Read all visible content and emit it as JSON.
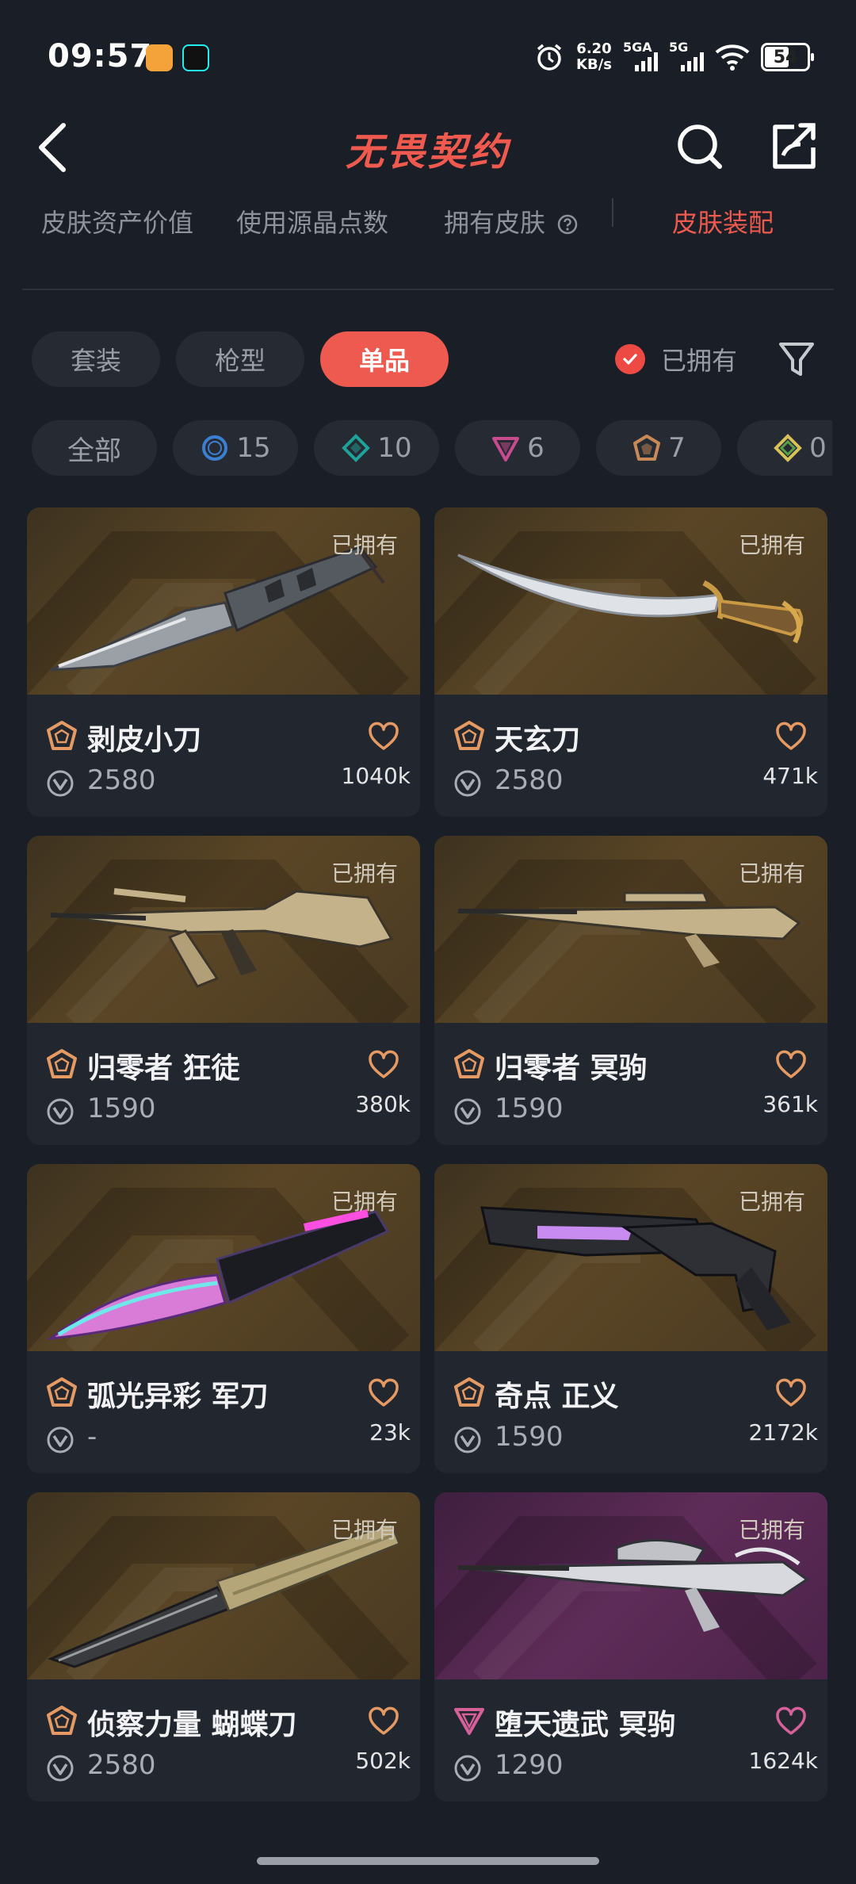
{
  "status_bar": {
    "time": "09:57",
    "net_speed_value": "6.20",
    "net_speed_unit": "KB/s",
    "signal1_label": "5GA",
    "signal2_label": "5G",
    "battery": "54",
    "app_icons": [
      "orange-app-icon",
      "tiktok-icon"
    ]
  },
  "header": {
    "title": "无畏契约",
    "back_icon": "chevron-left-icon",
    "search_icon": "search-icon",
    "share_icon": "share-icon"
  },
  "stats_tabs": [
    {
      "label": "皮肤资产价值"
    },
    {
      "label": "使用源晶点数"
    },
    {
      "label": "拥有皮肤"
    },
    {
      "label": "皮肤装配",
      "active": true
    }
  ],
  "type_filter": {
    "options": [
      "套装",
      "枪型",
      "单品"
    ],
    "selected": "单品",
    "owned_label": "已拥有",
    "owned_checked": true
  },
  "rarity_chips": [
    {
      "label": "全部",
      "icon": null
    },
    {
      "count": "15",
      "icon": "select-tier-icon",
      "color": "#3b7fd0"
    },
    {
      "count": "10",
      "icon": "deluxe-tier-icon",
      "color": "#1ea39a"
    },
    {
      "count": "6",
      "icon": "premium-tier-icon",
      "color": "#c94a8f"
    },
    {
      "count": "7",
      "icon": "exclusive-tier-icon",
      "color": "#c78a56"
    },
    {
      "count": "0",
      "icon": "ultra-tier-icon",
      "color": "#d7c25a"
    }
  ],
  "accent_colors": {
    "primary": "#ee5a50",
    "exclusive": "#e59a63",
    "premium": "#d6609a"
  },
  "cards": [
    {
      "name": "剥皮小刀",
      "price": "2580",
      "likes": "1040k",
      "owned_tag": "已拥有",
      "tier": "exclusive"
    },
    {
      "name": "天玄刀",
      "price": "2580",
      "likes": "471k",
      "owned_tag": "已拥有",
      "tier": "exclusive"
    },
    {
      "name": "归零者 狂徒",
      "price": "1590",
      "likes": "380k",
      "owned_tag": "已拥有",
      "tier": "exclusive"
    },
    {
      "name": "归零者 冥驹",
      "price": "1590",
      "likes": "361k",
      "owned_tag": "已拥有",
      "tier": "exclusive"
    },
    {
      "name": "弧光异彩 军刀",
      "price": "-",
      "likes": "23k",
      "owned_tag": "已拥有",
      "tier": "exclusive"
    },
    {
      "name": "奇点 正义",
      "price": "1590",
      "likes": "2172k",
      "owned_tag": "已拥有",
      "tier": "exclusive"
    },
    {
      "name": "侦察力量 蝴蝶刀",
      "price": "2580",
      "likes": "502k",
      "owned_tag": "已拥有",
      "tier": "exclusive"
    },
    {
      "name": "堕天遗武 冥驹",
      "price": "1290",
      "likes": "1624k",
      "owned_tag": "已拥有",
      "tier": "premium"
    }
  ]
}
